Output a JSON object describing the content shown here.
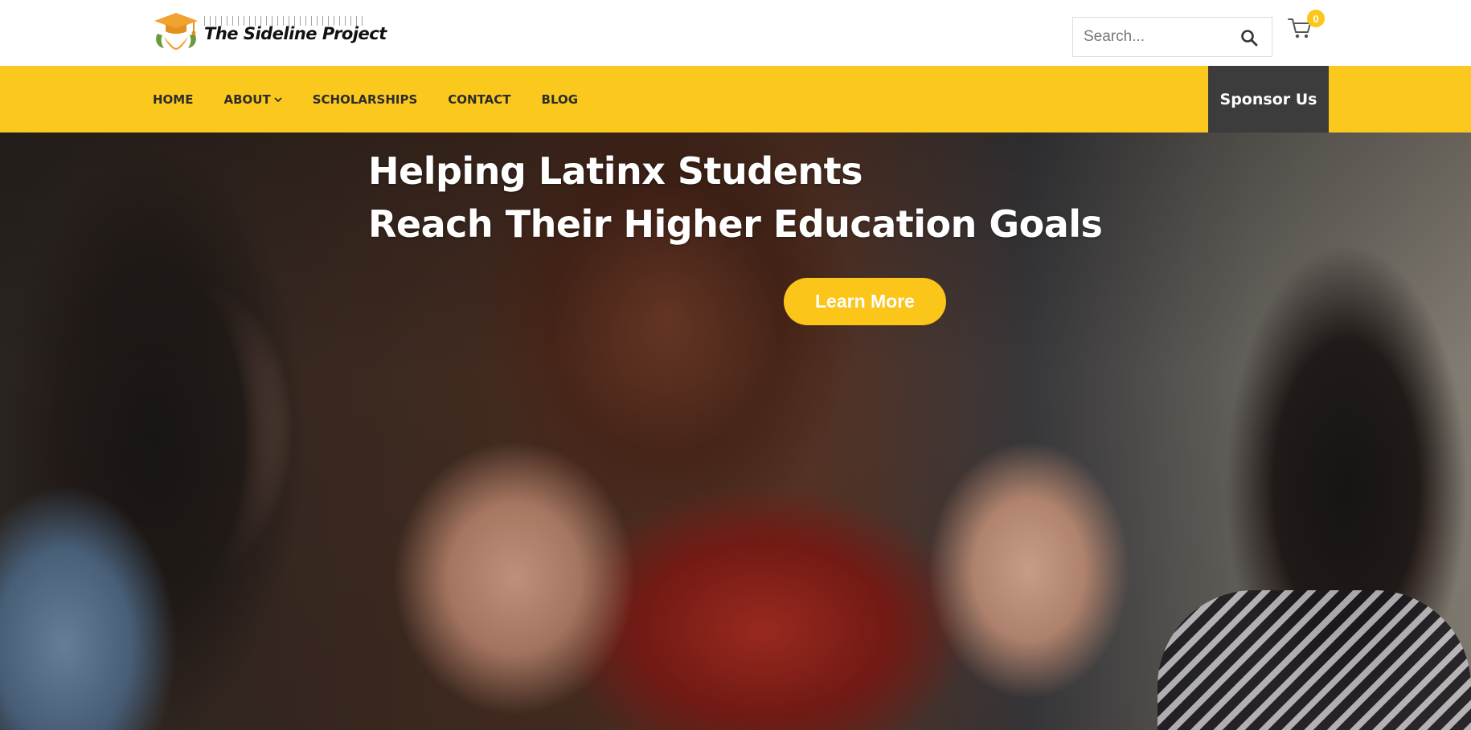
{
  "header": {
    "logo_text": "The Sideline Project",
    "search": {
      "placeholder": "Search..."
    },
    "cart": {
      "count": "0"
    }
  },
  "nav": {
    "items": [
      {
        "label": "HOME"
      },
      {
        "label": "ABOUT",
        "has_dropdown": true
      },
      {
        "label": "SCHOLARSHIPS"
      },
      {
        "label": "CONTACT"
      },
      {
        "label": "BLOG"
      }
    ],
    "sponsor_label": "Sponsor Us"
  },
  "hero": {
    "title_line1": "Helping Latinx Students",
    "title_line2": "Reach Their Higher Education Goals",
    "cta_label": "Learn More"
  },
  "colors": {
    "accent": "#fbc81d",
    "sponsor_bg": "#3c3c3c",
    "nav_text": "#2c2c2c"
  },
  "icons": [
    "graduation-cap-logo-icon",
    "search-icon",
    "cart-icon",
    "chevron-down-icon"
  ]
}
